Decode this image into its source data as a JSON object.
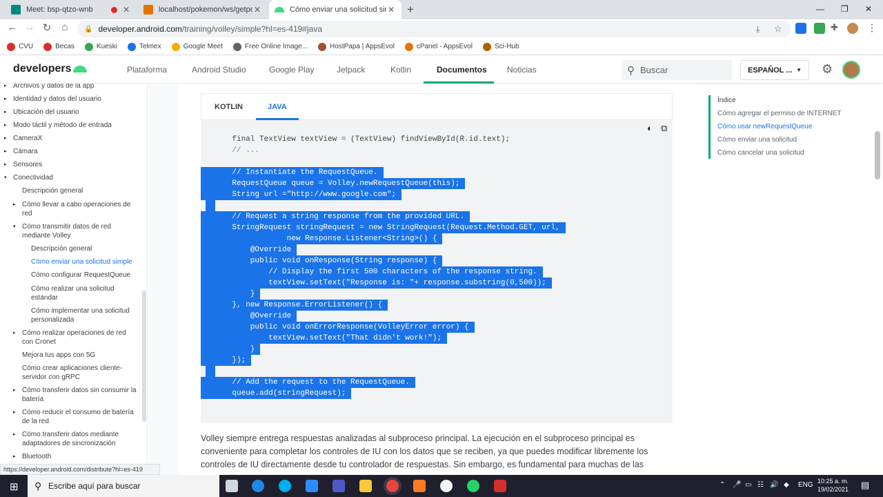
{
  "browser": {
    "tabs": [
      {
        "title": "Meet: bsp-qtzo-wnb",
        "recording": true
      },
      {
        "title": "localhost/pokemon/ws/getpoke"
      },
      {
        "title": "Cómo enviar una solicitud simple"
      }
    ],
    "new_tab": "+",
    "url_host": "developer.android.com",
    "url_path": "/training/volley/simple?hl=es-419#java",
    "bookmarks": [
      {
        "label": "CVU",
        "color": "#d93025"
      },
      {
        "label": "Becas",
        "color": "#d93025"
      },
      {
        "label": "Kueski",
        "color": "#34a853"
      },
      {
        "label": "Telmex",
        "color": "#1a73e8"
      },
      {
        "label": "Google Meet",
        "color": "#f9ab00"
      },
      {
        "label": "Free Online Image...",
        "color": "#5f6368"
      },
      {
        "label": "HostPapa | AppsEvol",
        "color": "#a0522d"
      },
      {
        "label": "cPanel - AppsEvol",
        "color": "#e8710a"
      },
      {
        "label": "Sci-Hub",
        "color": "#b06000"
      }
    ],
    "status_url": "https://developer.android.com/distribute?hl=es-419"
  },
  "site": {
    "logo": "developers",
    "nav": [
      "Plataforma",
      "Android Studio",
      "Google Play",
      "Jetpack",
      "Kotlin",
      "Documentos",
      "Noticias"
    ],
    "active_nav": "Documentos",
    "search_placeholder": "Buscar",
    "language": "ESPAÑOL ...",
    "accent": "#00a67a"
  },
  "sidebar": {
    "items": [
      {
        "label": "Archivos y datos de la app",
        "arrow": "▸",
        "level": 0
      },
      {
        "label": "Identidad y datos del usuario",
        "arrow": "▸",
        "level": 0
      },
      {
        "label": "Ubicación del usuario",
        "arrow": "▸",
        "level": 0
      },
      {
        "label": "Modo táctil y método de entrada",
        "arrow": "▸",
        "level": 0
      },
      {
        "label": "CameraX",
        "arrow": "▸",
        "level": 0
      },
      {
        "label": "Cámara",
        "arrow": "▸",
        "level": 0
      },
      {
        "label": "Sensores",
        "arrow": "▸",
        "level": 0
      },
      {
        "label": "Conectividad",
        "arrow": "▾",
        "level": 0
      },
      {
        "label": "Descripción general",
        "arrow": "",
        "level": 1
      },
      {
        "label": "Cómo llevar a cabo operaciones de red",
        "arrow": "▸",
        "level": 1
      },
      {
        "label": "Cómo transmitir datos de red mediante Volley",
        "arrow": "▾",
        "level": 1
      },
      {
        "label": "Descripción general",
        "arrow": "",
        "level": 2
      },
      {
        "label": "Cómo enviar una solicitud simple",
        "arrow": "",
        "level": 2,
        "current": true
      },
      {
        "label": "Cómo configurar RequestQueue",
        "arrow": "",
        "level": 2
      },
      {
        "label": "Cómo realizar una solicitud estándar",
        "arrow": "",
        "level": 2
      },
      {
        "label": "Cómo implementar una solicitud personalizada",
        "arrow": "",
        "level": 2
      },
      {
        "label": "Cómo realizar operaciones de red con Cronet",
        "arrow": "▸",
        "level": 1
      },
      {
        "label": "Mejora tus apps con 5G",
        "arrow": "",
        "level": 1
      },
      {
        "label": "Cómo crear aplicaciones cliente-servidor con gRPC",
        "arrow": "",
        "level": 1
      },
      {
        "label": "Cómo transferir datos sin consumir la batería",
        "arrow": "▸",
        "level": 1
      },
      {
        "label": "Cómo reducir el consumo de batería de la red",
        "arrow": "▸",
        "level": 1
      },
      {
        "label": "Cómo transferir datos mediante adaptadores de sincronización",
        "arrow": "▸",
        "level": 1
      },
      {
        "label": "Bluetooth",
        "arrow": "▸",
        "level": 1
      }
    ]
  },
  "code": {
    "tabs": [
      "KOTLIN",
      "JAVA"
    ],
    "active_tab": "JAVA",
    "lines": [
      {
        "text": "    final TextView textView = (TextView) findViewById(R.id.text);",
        "selected": false
      },
      {
        "text": "    // ...",
        "selected": false
      },
      {
        "text": "",
        "selected": false
      },
      {
        "text": "    // Instantiate the RequestQueue.",
        "selected": true
      },
      {
        "text": "    RequestQueue queue = Volley.newRequestQueue(this);",
        "selected": true
      },
      {
        "text": "    String url =\"http://www.google.com\";",
        "selected": true
      },
      {
        "text": "",
        "selected": true
      },
      {
        "text": "    // Request a string response from the provided URL.",
        "selected": true
      },
      {
        "text": "    StringRequest stringRequest = new StringRequest(Request.Method.GET, url,",
        "selected": true
      },
      {
        "text": "                new Response.Listener<String>() {",
        "selected": true
      },
      {
        "text": "        @Override",
        "selected": true
      },
      {
        "text": "        public void onResponse(String response) {",
        "selected": true
      },
      {
        "text": "            // Display the first 500 characters of the response string.",
        "selected": true
      },
      {
        "text": "            textView.setText(\"Response is: \"+ response.substring(0,500));",
        "selected": true
      },
      {
        "text": "        }",
        "selected": true
      },
      {
        "text": "    }, new Response.ErrorListener() {",
        "selected": true
      },
      {
        "text": "        @Override",
        "selected": true
      },
      {
        "text": "        public void onErrorResponse(VolleyError error) {",
        "selected": true
      },
      {
        "text": "            textView.setText(\"That didn't work!\");",
        "selected": true
      },
      {
        "text": "        }",
        "selected": true
      },
      {
        "text": "    });",
        "selected": true
      },
      {
        "text": "",
        "selected": true
      },
      {
        "text": "    // Add the request to the RequestQueue.",
        "selected": true
      },
      {
        "text": "    queue.add(stringRequest);",
        "selected": true
      }
    ],
    "selection_color": "#1a73e8"
  },
  "paragraph": "Volley siempre entrega respuestas analizadas al subproceso principal. La ejecución en el subproceso principal es conveniente para completar los controles de IU con los datos que se reciben, ya que puedes modificar libremente los controles de IU directamente desde tu controlador de respuestas. Sin embargo, es fundamental para muchas de las",
  "toc": {
    "heading": "Índice",
    "items": [
      {
        "label": "Cómo agregar el permiso de INTERNET"
      },
      {
        "label": "Cómo usar newRequestQueue",
        "current": true
      },
      {
        "label": "Cómo enviar una solicitud"
      },
      {
        "label": "Cómo cancelar una solicitud"
      }
    ]
  },
  "taskbar": {
    "search_placeholder": "Escribe aquí para buscar",
    "language": "ENG",
    "time": "10:25 a. m.",
    "date": "19/02/2021"
  }
}
